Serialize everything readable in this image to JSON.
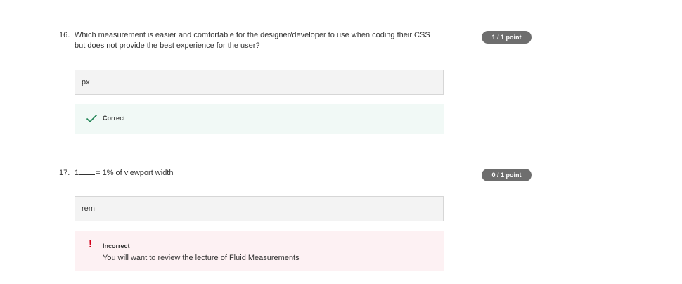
{
  "questions": [
    {
      "number": "16.",
      "text": "Which measurement is easier and comfortable for the designer/developer to use when coding their CSS but does not provide the best experience for the user?",
      "points": "1 / 1 point",
      "answer": "px",
      "feedback": {
        "status": "Correct",
        "icon": "checkmark-icon",
        "color": "#1f8354"
      }
    },
    {
      "number": "17.",
      "text_before": "1",
      "text_after": "= 1% of viewport width",
      "points": "0 / 1 point",
      "answer": "rem",
      "feedback": {
        "status": "Incorrect",
        "message": "You will want to review the lecture of Fluid Measurements",
        "icon": "exclamation-icon",
        "color": "#d3001a"
      }
    }
  ]
}
